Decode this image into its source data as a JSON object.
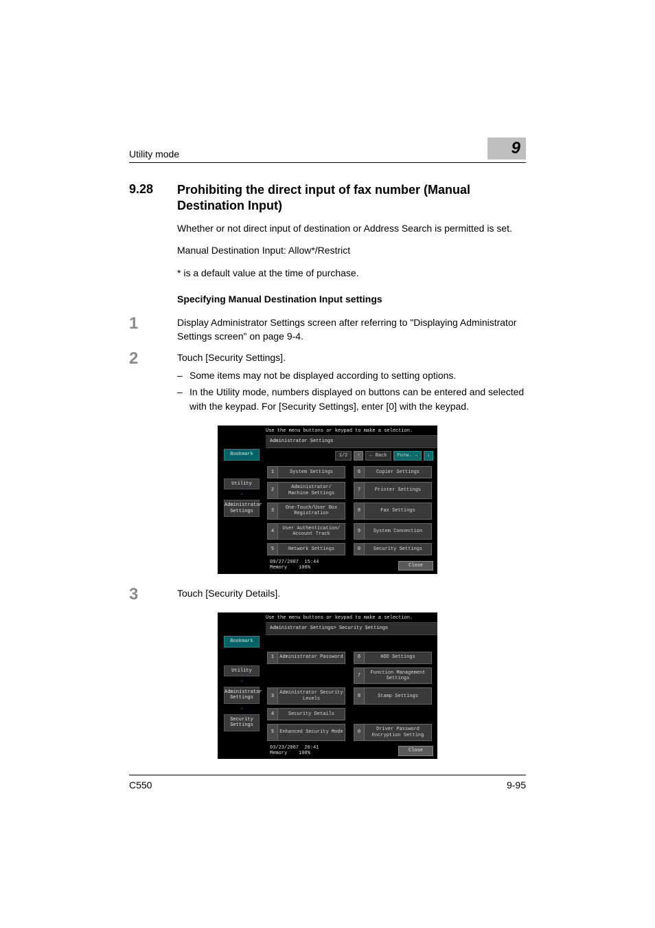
{
  "header": {
    "left": "Utility mode",
    "chapter": "9"
  },
  "section": {
    "number": "9.28",
    "title": "Prohibiting the direct input of fax number (Manual Destination Input)"
  },
  "intro": [
    "Whether or not direct input of destination or Address Search is permitted is set.",
    "Manual Destination Input: Allow*/Restrict",
    "* is a default value at the time of purchase."
  ],
  "subhead": "Specifying Manual Destination Input settings",
  "steps": [
    {
      "n": "1",
      "text": "Display Administrator Settings screen after referring to \"Displaying Administrator Settings screen\" on page 9-4.",
      "bullets": []
    },
    {
      "n": "2",
      "text": "Touch [Security Settings].",
      "bullets": [
        "Some items may not be displayed according to setting options.",
        "In the Utility mode, numbers displayed on buttons can be entered and selected with the keypad. For [Security Settings], enter [0] with the keypad."
      ]
    },
    {
      "n": "3",
      "text": "Touch [Security Details].",
      "bullets": []
    }
  ],
  "screen_common": {
    "prompt": "Use the menu buttons or keypad to make a selection.",
    "bookmark": "Bookmark",
    "pager_page": "1/2",
    "back": "Back",
    "fwd": "Forw.",
    "close": "Close",
    "memory_label": "Memory",
    "memory_value": "100%"
  },
  "screen1": {
    "breadcrumb": "Administrator Settings",
    "pager_visible": true,
    "side": [
      "Utility",
      "Administrator\nSettings"
    ],
    "left_options": [
      {
        "n": "1",
        "label": "System Settings"
      },
      {
        "n": "2",
        "label": "Administrator/\nMachine Settings"
      },
      {
        "n": "3",
        "label": "One-Touch/User Box\nRegistration"
      },
      {
        "n": "4",
        "label": "User Authentication/\nAccount Track"
      },
      {
        "n": "5",
        "label": "Network Settings"
      }
    ],
    "right_options": [
      {
        "n": "6",
        "label": "Copier Settings"
      },
      {
        "n": "7",
        "label": "Printer Settings"
      },
      {
        "n": "8",
        "label": "Fax Settings"
      },
      {
        "n": "9",
        "label": "System Connection"
      },
      {
        "n": "0",
        "label": "Security Settings"
      }
    ],
    "datetime": {
      "date": "09/27/2007",
      "time": "15:44"
    }
  },
  "screen2": {
    "breadcrumb": "Administrator Settings> Security Settings",
    "pager_visible": false,
    "side": [
      "Utility",
      "Administrator\nSettings",
      "Security\nSettings"
    ],
    "left_options": [
      {
        "n": "1",
        "label": "Administrator Password"
      },
      {
        "n": "3",
        "label": "Administrator Security\nLevels"
      },
      {
        "n": "4",
        "label": "Security Details"
      },
      {
        "n": "5",
        "label": "Enhanced Security Mode"
      }
    ],
    "right_options": [
      {
        "n": "6",
        "label": "HDD Settings"
      },
      {
        "n": "7",
        "label": "Function Management Settings"
      },
      {
        "n": "8",
        "label": "Stamp Settings"
      },
      {
        "n": "0",
        "label": "Driver Password\nEncryption Setting"
      }
    ],
    "datetime": {
      "date": "03/23/2007",
      "time": "20:41"
    }
  },
  "footer": {
    "left": "C550",
    "right": "9-95"
  }
}
